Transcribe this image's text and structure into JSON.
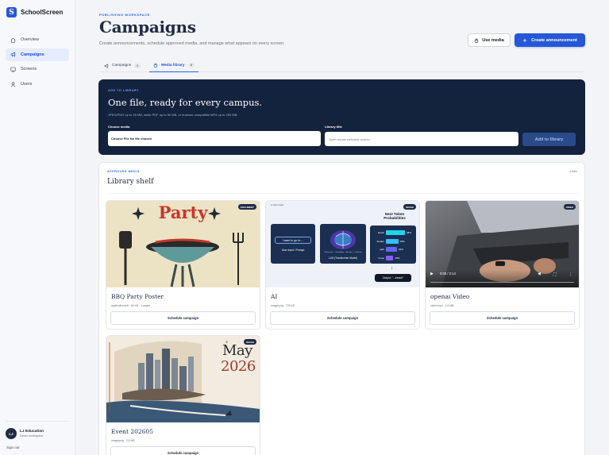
{
  "app": {
    "logo_letter": "S",
    "name": "SchoolScreen"
  },
  "sidebar": {
    "items": [
      {
        "label": "Overview",
        "icon": "home-icon",
        "active": false
      },
      {
        "label": "Campaigns",
        "icon": "megaphone-icon",
        "active": true
      },
      {
        "label": "Screens",
        "icon": "monitor-icon",
        "active": false
      },
      {
        "label": "Users",
        "icon": "user-icon",
        "active": false
      }
    ],
    "user": {
      "initials": "LJ",
      "name": "LJ Education",
      "workspace": "Demo workspace"
    },
    "sign_out": "Sign out"
  },
  "header": {
    "eyebrow": "PUBLISHING WORKSPACE",
    "title": "Campaigns",
    "subtitle": "Create announcements, schedule approved media, and manage what appears on every screen.",
    "use_media_label": "Use media",
    "create_label": "Create announcement"
  },
  "tabs": [
    {
      "label": "Campaigns",
      "count": "0",
      "icon": "megaphone-icon",
      "active": false
    },
    {
      "label": "Media library",
      "count": "4",
      "icon": "lock-icon",
      "active": true
    }
  ],
  "upload": {
    "eyebrow": "ADD TO LIBRARY",
    "title": "One file, ready for every campus.",
    "subtitle": "JPEG/PNG up to 25 MB, static PDF up to 50 MB, or browser-compatible MP4 up to 250 MB.",
    "choose_label": "Choose media",
    "file_text": "Choose File  No file chosen",
    "title_label": "Library title",
    "title_placeholder": "Open house welcome screen",
    "add_label": "Add to library"
  },
  "library": {
    "eyebrow": "APPROVED MEDIA",
    "title": "Library shelf",
    "count": "4 files",
    "schedule_label": "Schedule campaign",
    "items": [
      {
        "title": "BBQ Party Poster",
        "meta": "application/pdf · 56 KB · 1 pages",
        "type": "DOCUMENT",
        "poster_text": "Party"
      },
      {
        "title": "AI",
        "meta": "image/png · 729 KB",
        "type": "IMAGE",
        "diagram": {
          "caption": "1 User input",
          "heading": "Next Token Probabilities",
          "prompt": "I want to go to ...",
          "prompt_label": "User Input / Prompt",
          "model_label": "LLM (Transformer Model)",
          "model_sub": "Tokenization → Embedding → Attention → Prediction",
          "output_label": "Output: \"...beach\"",
          "tokens": [
            {
              "word": "beach",
              "pct": 38
            },
            {
              "word": "theater",
              "pct": 25
            },
            {
              "word": "park",
              "pct": 22
            },
            {
              "word": "home",
              "pct": 15
            }
          ]
        }
      },
      {
        "title": "openai Video",
        "meta": "video/mp4 · 4.5 MB",
        "type": "VIDEO",
        "time": "0:00 / 2:14"
      },
      {
        "title": "Event 202605",
        "meta": "image/png · 2.5 MB",
        "type": "IMAGE",
        "month": "May",
        "year": "2026"
      }
    ]
  },
  "colors": {
    "accent": "#2557d6",
    "dark_card": "#13223d",
    "title": "#1f2a44"
  }
}
